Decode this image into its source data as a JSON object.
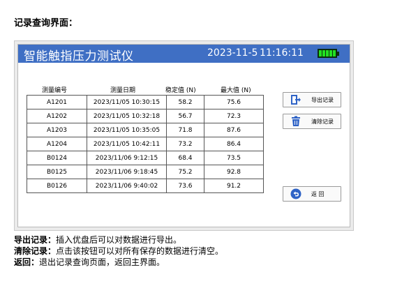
{
  "heading": "记录查询界面：",
  "device": {
    "title": "智能触指压力测试仪",
    "date": "2023-11-5",
    "time": "11:16:11",
    "battery_icon": "battery-full-icon",
    "battery_level": 1.0,
    "colors": {
      "titlebar": "#3f6fc4",
      "battery": "#22e022"
    }
  },
  "table": {
    "headers": [
      "测量编号",
      "测量日期",
      "稳定值 (N)",
      "最大值 (N)"
    ],
    "rows": [
      [
        "A1201",
        "2023/11/05  10:30:15",
        "58.2",
        "75.6"
      ],
      [
        "A1202",
        "2023/11/05  10:32:18",
        "56.7",
        "72.3"
      ],
      [
        "A1203",
        "2023/11/05  10:35:05",
        "71.8",
        "87.6"
      ],
      [
        "A1204",
        "2023/11/05  10:42:11",
        "73.2",
        "86.4"
      ],
      [
        "B0124",
        "2023/11/06  9:12:15",
        "68.4",
        "73.5"
      ],
      [
        "B0125",
        "2023/11/06  9:18:45",
        "75.2",
        "92.8"
      ],
      [
        "B0126",
        "2023/11/06  9:40:02",
        "73.6",
        "91.2"
      ]
    ]
  },
  "buttons": {
    "export": {
      "label": "导出记录",
      "icon": "export-icon"
    },
    "clear": {
      "label": "清除记录",
      "icon": "trash-icon"
    },
    "back": {
      "label": "返 回",
      "icon": "back-arrow-icon"
    }
  },
  "descriptions": [
    {
      "term": "导出记录：",
      "text": "插入优盘后可以对数据进行导出。"
    },
    {
      "term": "清除记录：",
      "text": "点击该按钮可以对所有保存的数据进行清空。"
    },
    {
      "term": "返回：",
      "text": "退出记录查询页面，返回主界面。"
    }
  ]
}
